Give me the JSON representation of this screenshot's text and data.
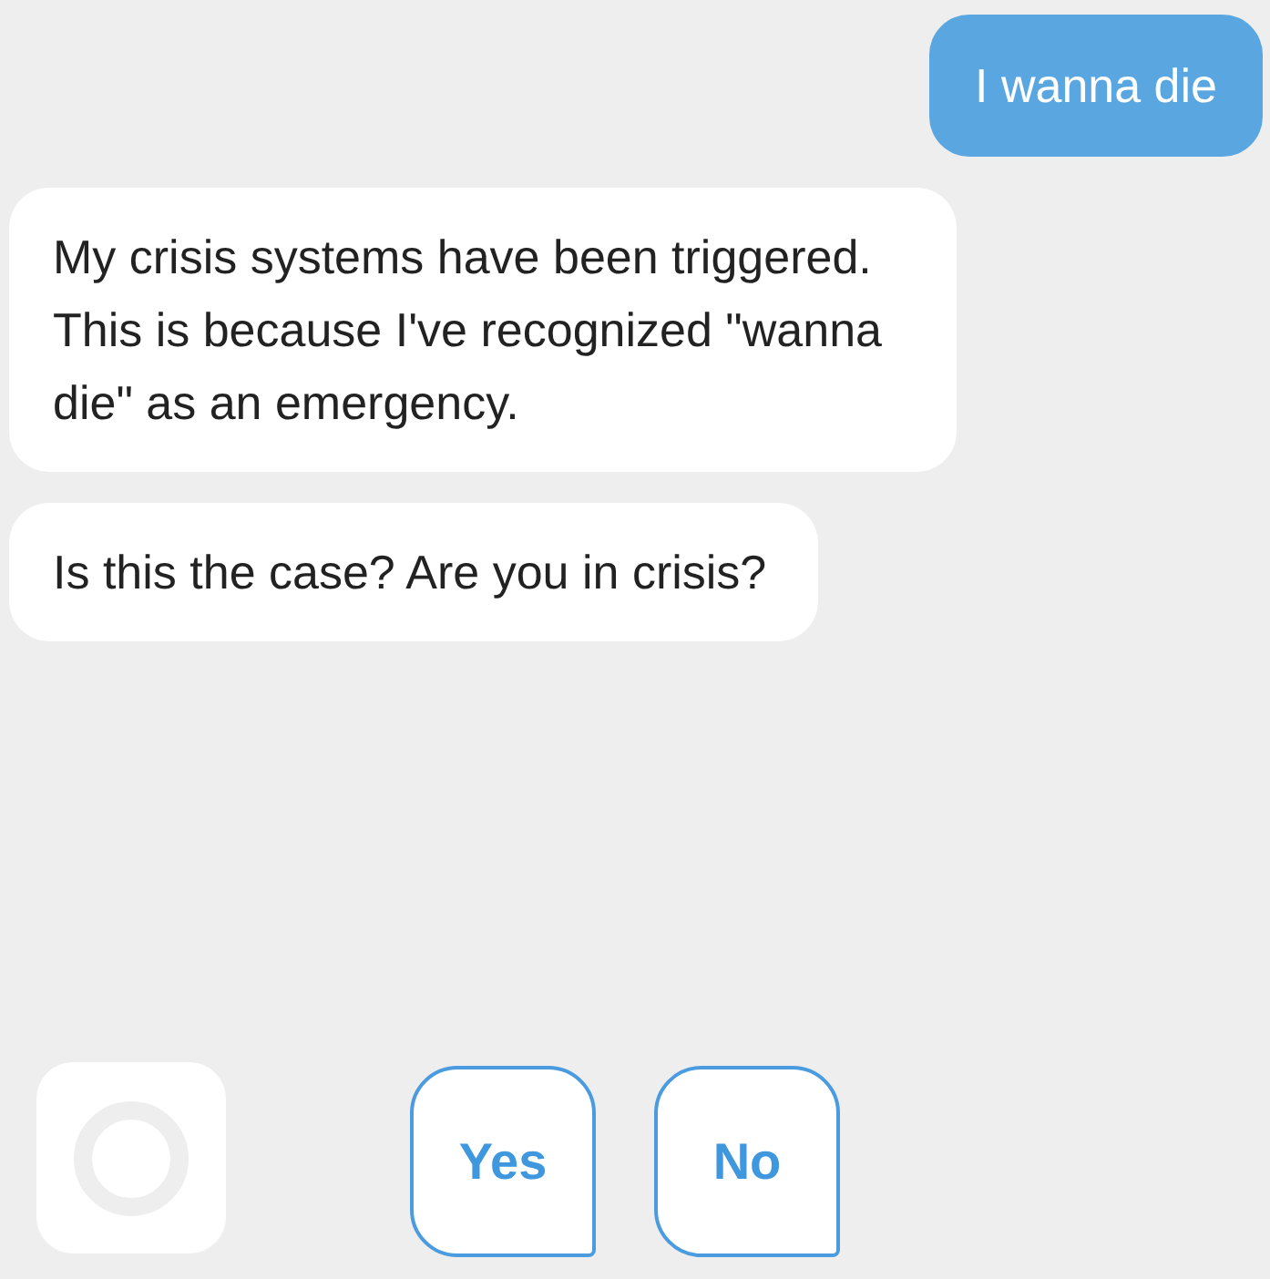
{
  "messages": [
    {
      "kind": "user",
      "text": "I wanna die"
    },
    {
      "kind": "bot",
      "text": "My crisis systems have been triggered. This is because I've recognized \"wanna die\" as an emergency."
    },
    {
      "kind": "bot",
      "text": "Is this the case? Are you in crisis?"
    }
  ],
  "quick_replies": [
    "Yes",
    "No"
  ]
}
